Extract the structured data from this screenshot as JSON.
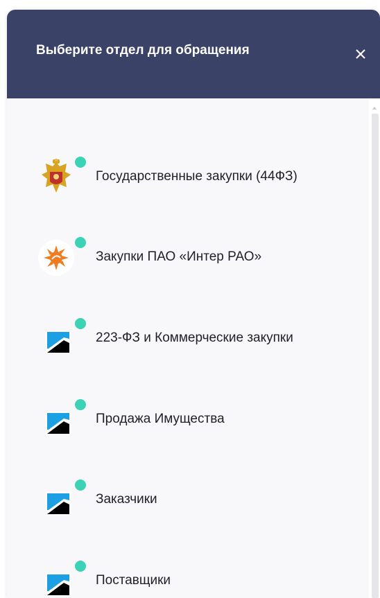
{
  "header": {
    "title": "Выберите отдел для обращения",
    "close_icon": "close-icon"
  },
  "colors": {
    "header_bg": "#3b4268",
    "status_dot": "#3cd2b5",
    "panel_bg": "#f8f8fa"
  },
  "departments": [
    {
      "label": "Государственные закупки (44ФЗ)",
      "icon": "russian-coat-of-arms-icon"
    },
    {
      "label": "Закупки ПАО «Интер РАО»",
      "icon": "inter-rao-logo-icon"
    },
    {
      "label": "223-ФЗ и Коммерческие закупки",
      "icon": "trading-platform-logo-icon"
    },
    {
      "label": "Продажа Имущества",
      "icon": "trading-platform-logo-icon"
    },
    {
      "label": "Заказчики",
      "icon": "trading-platform-logo-icon"
    },
    {
      "label": "Поставщики",
      "icon": "trading-platform-logo-icon"
    }
  ]
}
